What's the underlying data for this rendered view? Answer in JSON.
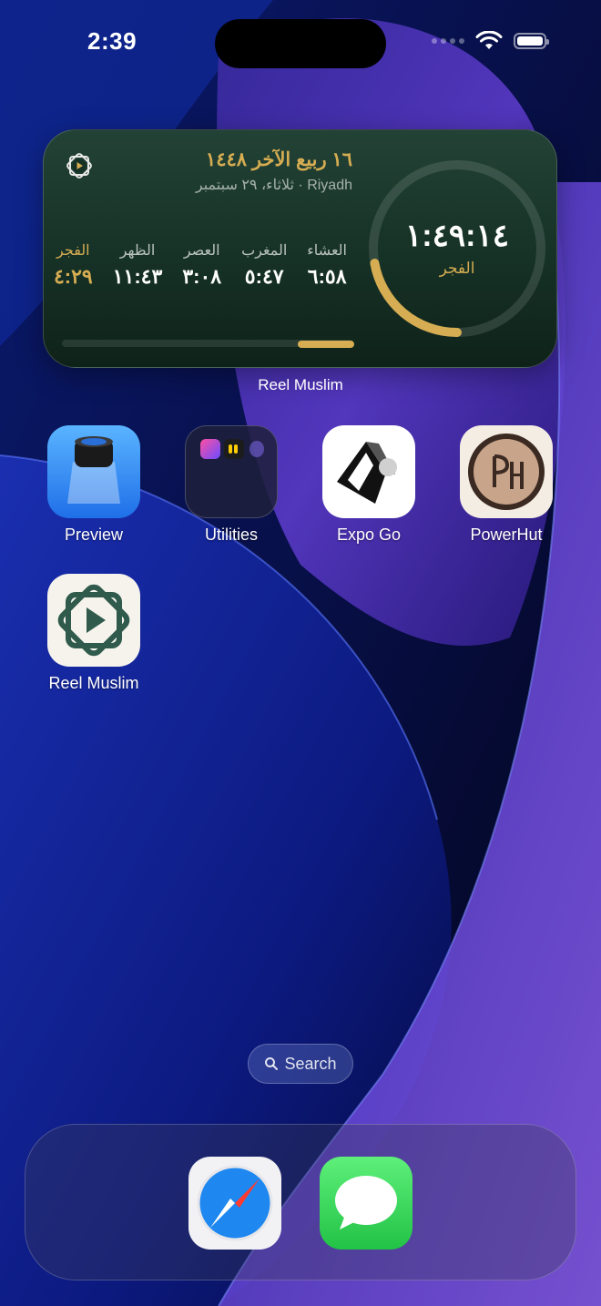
{
  "status_bar": {
    "time": "2:39"
  },
  "widget": {
    "hijri_date": "١٦ ربيع الآخر ١٤٤٨",
    "gregorian_line": "Riyadh · ثلاثاء، ٢٩ سبتمبر",
    "prayers": [
      {
        "name": "الفجر",
        "time": "٤:٢٩"
      },
      {
        "name": "الظهر",
        "time": "١١:٤٣"
      },
      {
        "name": "العصر",
        "time": "٣:٠٨"
      },
      {
        "name": "المغرب",
        "time": "٥:٤٧"
      },
      {
        "name": "العشاء",
        "time": "٦:٥٨"
      }
    ],
    "countdown": "١:٤٩:١٤",
    "countdown_label": "الفجر",
    "caption": "Reel Muslim",
    "accent_color": "#d6ad52"
  },
  "apps": [
    {
      "label": "Preview",
      "icon": "preview-icon"
    },
    {
      "label": "Utilities",
      "icon": "folder-icon"
    },
    {
      "label": "Expo Go",
      "icon": "expo-go-icon"
    },
    {
      "label": "PowerHut",
      "icon": "powerhut-icon"
    },
    {
      "label": "Reel Muslim",
      "icon": "reel-muslim-icon"
    }
  ],
  "search": {
    "label": "Search"
  },
  "dock": [
    {
      "icon": "safari-icon"
    },
    {
      "icon": "messages-icon"
    }
  ]
}
